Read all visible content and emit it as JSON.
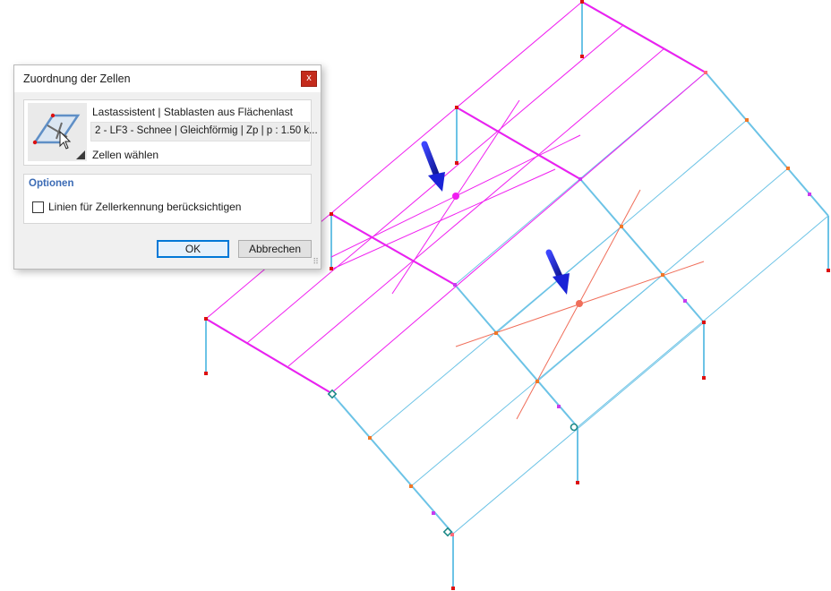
{
  "dialog": {
    "title": "Zuordnung der Zellen",
    "close_label": "x",
    "wizard": {
      "title": "Lastassistent | Stablasten aus Flächenlast",
      "load_selection": "2 - LF3 - Schnee | Gleichförmig | Zp | p : 1.50 k...",
      "select_cells_label": "Zellen wählen",
      "icon": "cell-selection-icon"
    },
    "options": {
      "header": "Optionen",
      "line_checkbox_label": "Linien für Zellerkennung berücksichtigen",
      "line_checkbox_checked": false
    },
    "ok_label": "OK",
    "cancel_label": "Abbrechen"
  },
  "colors": {
    "magenta": "#f01ef0",
    "structure": "#6cc3e6",
    "support": "#dd1010",
    "node_orange": "#f07828",
    "salmon": "#f06e5a",
    "arrow": "#1a23d6",
    "hinge": "#1e8a88"
  }
}
